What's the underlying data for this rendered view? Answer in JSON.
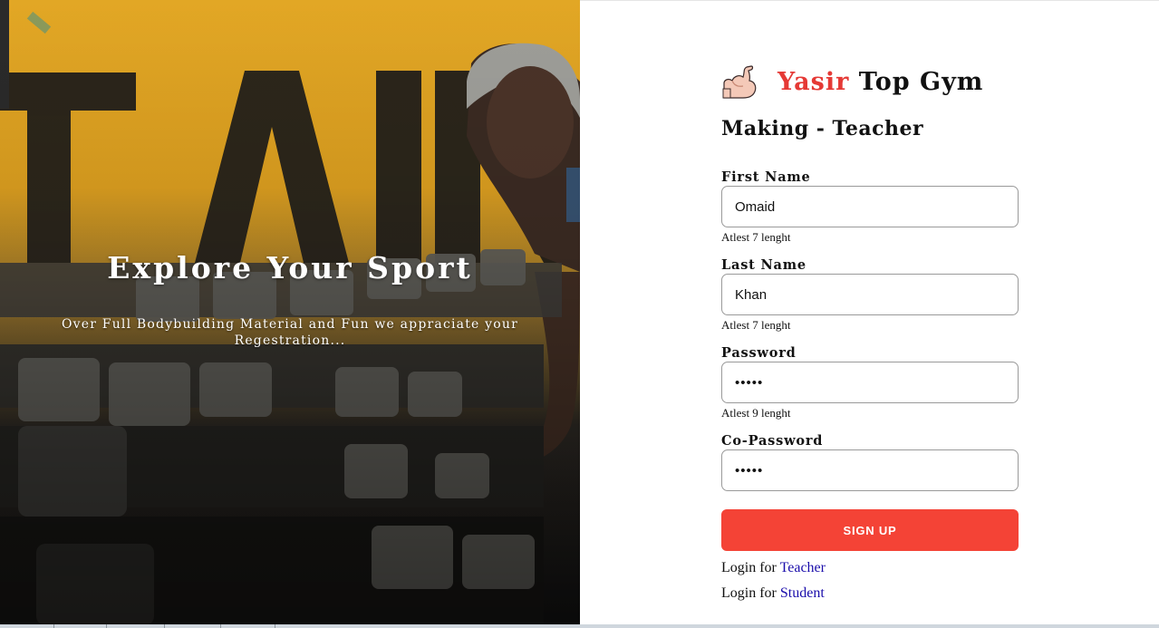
{
  "hero": {
    "title": "Explore Your Sport",
    "subtitle": "Over Full Bodybuilding Material and Fun we appraciate your Regestration..."
  },
  "brand": {
    "name_accent": "Yasir",
    "name_rest": " Top Gym",
    "logo_icon": "flexed-biceps-icon"
  },
  "form": {
    "title": "Making - Teacher",
    "fields": [
      {
        "label": "First Name",
        "value": "Omaid",
        "type": "text",
        "hint": "Atlest 7 lenght"
      },
      {
        "label": "Last Name",
        "value": "Khan",
        "type": "text",
        "hint": "Atlest 7 lenght"
      },
      {
        "label": "Password",
        "value": "•••••",
        "type": "password",
        "hint": "Atlest 9 lenght"
      },
      {
        "label": "Co-Password",
        "value": "•••••",
        "type": "password"
      }
    ],
    "submit_label": "SIGN UP"
  },
  "login_links": [
    {
      "prefix": "Login for ",
      "link": "Teacher"
    },
    {
      "prefix": "Login for ",
      "link": "Student"
    }
  ],
  "colors": {
    "accent": "#e53935",
    "button": "#f44336",
    "link": "#1a0dab"
  }
}
